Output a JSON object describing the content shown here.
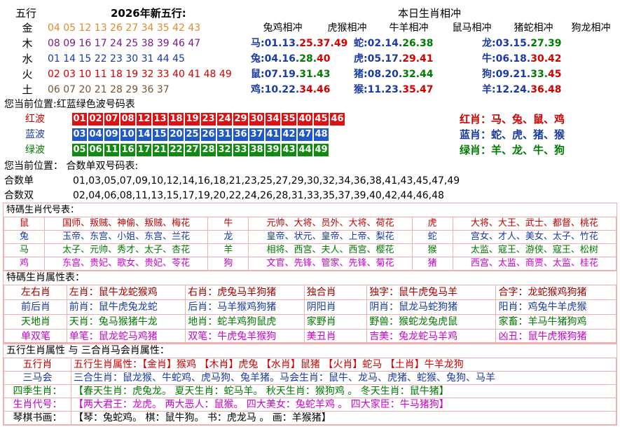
{
  "top": {
    "wuxing_title": "五行",
    "year_title": "2026年新五行:",
    "chong_title": "本日生肖相冲",
    "wuxing": [
      {
        "label": "金",
        "nums": "04 05 12 13 26 27 34 35 42 43"
      },
      {
        "label": "木",
        "nums": "08 09 16 17 24 25 38 39 46 47"
      },
      {
        "label": "水",
        "nums": "01 14 15 22 23 30 31 44 45"
      },
      {
        "label": "火",
        "nums": "02 03 10 11 18 19 32 33 40 41 48 49"
      },
      {
        "label": "土",
        "nums": "06 07 20 21 28 29 36 37"
      }
    ],
    "chong_headers": [
      "兔鸡相冲",
      "虎猴相冲",
      "牛羊相冲",
      "鼠马相冲",
      "猪蛇相冲",
      "狗龙相冲"
    ],
    "chong_rows": [
      [
        {
          "zodiac": "马:",
          "p1": "01.13.",
          "p2": "25.37.",
          "p3": "49",
          "c2": "cr"
        },
        {
          "zodiac": "蛇:",
          "p1": "02.14.",
          "p2": "26.38",
          "p3": "",
          "c2": "cg"
        },
        {
          "zodiac": "龙:",
          "p1": "03.15.",
          "p2": "27.39",
          "p3": "",
          "c2": "cg"
        }
      ],
      [
        {
          "zodiac": "兔:",
          "p1": "04.16.",
          "p2": "28.",
          "p3": "40",
          "c2": "cg"
        },
        {
          "zodiac": "虎:",
          "p1": "05.17.",
          "p2": "29.41",
          "p3": "",
          "c2": "cr"
        },
        {
          "zodiac": "牛:",
          "p1": "06.18.",
          "p2": "30.42",
          "p3": "",
          "c2": "cr"
        }
      ],
      [
        {
          "zodiac": "鼠:",
          "p1": "07.19.",
          "p2": "31.43",
          "p3": "",
          "c2": "cg"
        },
        {
          "zodiac": "猪:",
          "p1": "08.20.",
          "p2": "32.44",
          "p3": "",
          "c2": "cg"
        },
        {
          "zodiac": "狗:",
          "p1": "09.21.",
          "p2": "33.",
          "p3": "45",
          "c2": "cg"
        }
      ],
      [
        {
          "zodiac": "鸡:",
          "p1": "10.22.",
          "p2": "34.46",
          "p3": "",
          "c2": "cr"
        },
        {
          "zodiac": "猴:",
          "p1": "11.23.",
          "p2": "35.47",
          "p3": "",
          "c2": "cr"
        },
        {
          "zodiac": "羊:",
          "p1": "12.24.",
          "p2": "36.48",
          "p3": "",
          "c2": "cr"
        }
      ]
    ]
  },
  "waves": {
    "position_text": "您当前位置:红蓝绿色波号码表",
    "rows": [
      {
        "label": "红波",
        "color": "red",
        "nums": [
          "01",
          "02",
          "07",
          "08",
          "12",
          "13",
          "18",
          "19",
          "23",
          "24",
          "29",
          "30",
          "34",
          "35",
          "40",
          "45",
          "46"
        ],
        "xiao": "红肖：马、兔、鼠、鸡",
        "xiao_color": "#d40000"
      },
      {
        "label": "蓝波",
        "color": "blue",
        "nums": [
          "03",
          "04",
          "09",
          "10",
          "14",
          "15",
          "20",
          "25",
          "26",
          "31",
          "36",
          "37",
          "41",
          "42",
          "47",
          "48"
        ],
        "xiao": "蓝肖：蛇、虎、猪、猴",
        "xiao_color": "#1a3aa6"
      },
      {
        "label": "绿波",
        "color": "green",
        "nums": [
          "05",
          "06",
          "11",
          "16",
          "17",
          "21",
          "22",
          "27",
          "28",
          "32",
          "33",
          "38",
          "39",
          "43",
          "44",
          "49"
        ],
        "xiao": "绿肖：羊、龙、牛、狗",
        "xiao_color": "#007a00"
      }
    ]
  },
  "heshu": {
    "position_text": "您当前位置： 合数单双号码表:",
    "dan_label": "合数单",
    "dan_nums": "01,03,05,07,09,10,12,14,16,18,21,23,25,27,29,30,32,34,36,38,41,43,45,47,49",
    "shuang_label": "合数双",
    "shuang_nums": "02,04,06,08,11,13,15,17,19,20,22,24,26,28,31,33,35,37,39,40,42,44,46,48"
  },
  "code_table": {
    "header": "特碼生肖代号表：",
    "rows": [
      {
        "color": "#c00000",
        "cells": [
          "鼠",
          "国师、叛贼、神偷、叛贼、梅花",
          "牛",
          "元帅、大将、员外、大将、荷花",
          "虎",
          "大将、大王、武士、都督、桃花"
        ]
      },
      {
        "color": "#1a3aa6",
        "cells": [
          "兔",
          "玉帝、东宫、小姐、东宫、兰花",
          "龙",
          "皇帝、状元、皇帝、上帝、梨花",
          "蛇",
          "宫女、才人、美女、太子、竹花"
        ]
      },
      {
        "color": "#007a00",
        "cells": [
          "马",
          "太子、元帅、秀才、太子、杏花",
          "羊",
          "相将、西宫、夫人、西宫、樱花",
          "猴",
          "太监、寇王、游侠、寇王、松树"
        ]
      },
      {
        "color": "#cc00cc",
        "cells": [
          "鸡",
          "东宫、贵妃、歌女、贵妃、苓花",
          "狗",
          "文官、先锋、管家、先锋、菊花",
          "猪",
          "西宫、太监、商贾、太监、桂花"
        ]
      }
    ]
  },
  "attr_table": {
    "header": "特碼生肖属性表：",
    "rows": [
      {
        "cls": "c1",
        "cells": [
          "左右肖",
          "左肖：鼠牛龙蛇猴鸡",
          "右肖：虎兔马羊狗猪",
          "独合肖",
          "独字：鼠牛虎兔马羊",
          "合字：龙蛇猴鸡狗猪"
        ]
      },
      {
        "cls": "c2",
        "cells": [
          "前后肖",
          "前肖：鼠牛虎兔龙蛇",
          "后肖：马羊猴鸡狗猪",
          "阴阳肖",
          "阴肖：鼠龙马蛇狗猪",
          "阳肖：鸡兔牛羊虎猴"
        ]
      },
      {
        "cls": "c3",
        "cells": [
          "天地肖",
          "天肖：兔马猴猪牛龙",
          "地肖：蛇羊鸡狗鼠虎",
          "家野肖",
          "野兽：猴蛇龙兔虎鼠",
          "家畜：羊马牛猪狗鸡"
        ]
      },
      {
        "cls": "c4",
        "cells": [
          "单双笔",
          "单笔：鼠龙蛇马鸡猪",
          "双笔：牛虎兔羊猴狗",
          "美丑肖",
          "吉美：兔龙蛇马羊鸡",
          "凶丑：鼠牛虎猴狗猪"
        ]
      }
    ]
  },
  "wx_table": {
    "header": "五行生肖属性 与 三合肖马会肖属性：",
    "rows": [
      {
        "label": "五行肖",
        "label_cls": "red-t",
        "text": "五行生肖属性：【金肖】猴鸡 【木肖】虎兔 【水肖】鼠猪 【火肖】蛇马 【土肖】牛羊龙狗",
        "text_cls": "red-t"
      },
      {
        "label": "三马会",
        "label_cls": "blue-t",
        "text": "三合生肖：鼠龙猴、牛蛇鸡、虎马狗、兔羊猪。马会生肖：鼠牛、龙马、虎猪、蛇猴、兔狗、马羊",
        "text_cls": "blue-t"
      },
      {
        "label": "四季生肖：",
        "label_cls": "green-t",
        "text": "【春天生肖：虎兔龙。 夏天生肖：蛇马羊。 秋天生肖：猴狗鸡 。 冬天生肖：鼠牛猪】",
        "text_cls": "green-t"
      },
      {
        "label": "生肖代号：",
        "label_cls": "mag-t",
        "text": "【两大君王：龙虎。 两大恶人：鼠猴。 四大美女：兔蛇羊鸡 。 四大家臣：牛马猪狗】",
        "text_cls": "mag-t"
      },
      {
        "label": "琴棋书画：",
        "label_cls": "",
        "text": "【琴：兔蛇鸡。 棋：鼠牛狗。 书：虎龙马 。 画：羊猴猪】",
        "text_cls": ""
      }
    ]
  }
}
